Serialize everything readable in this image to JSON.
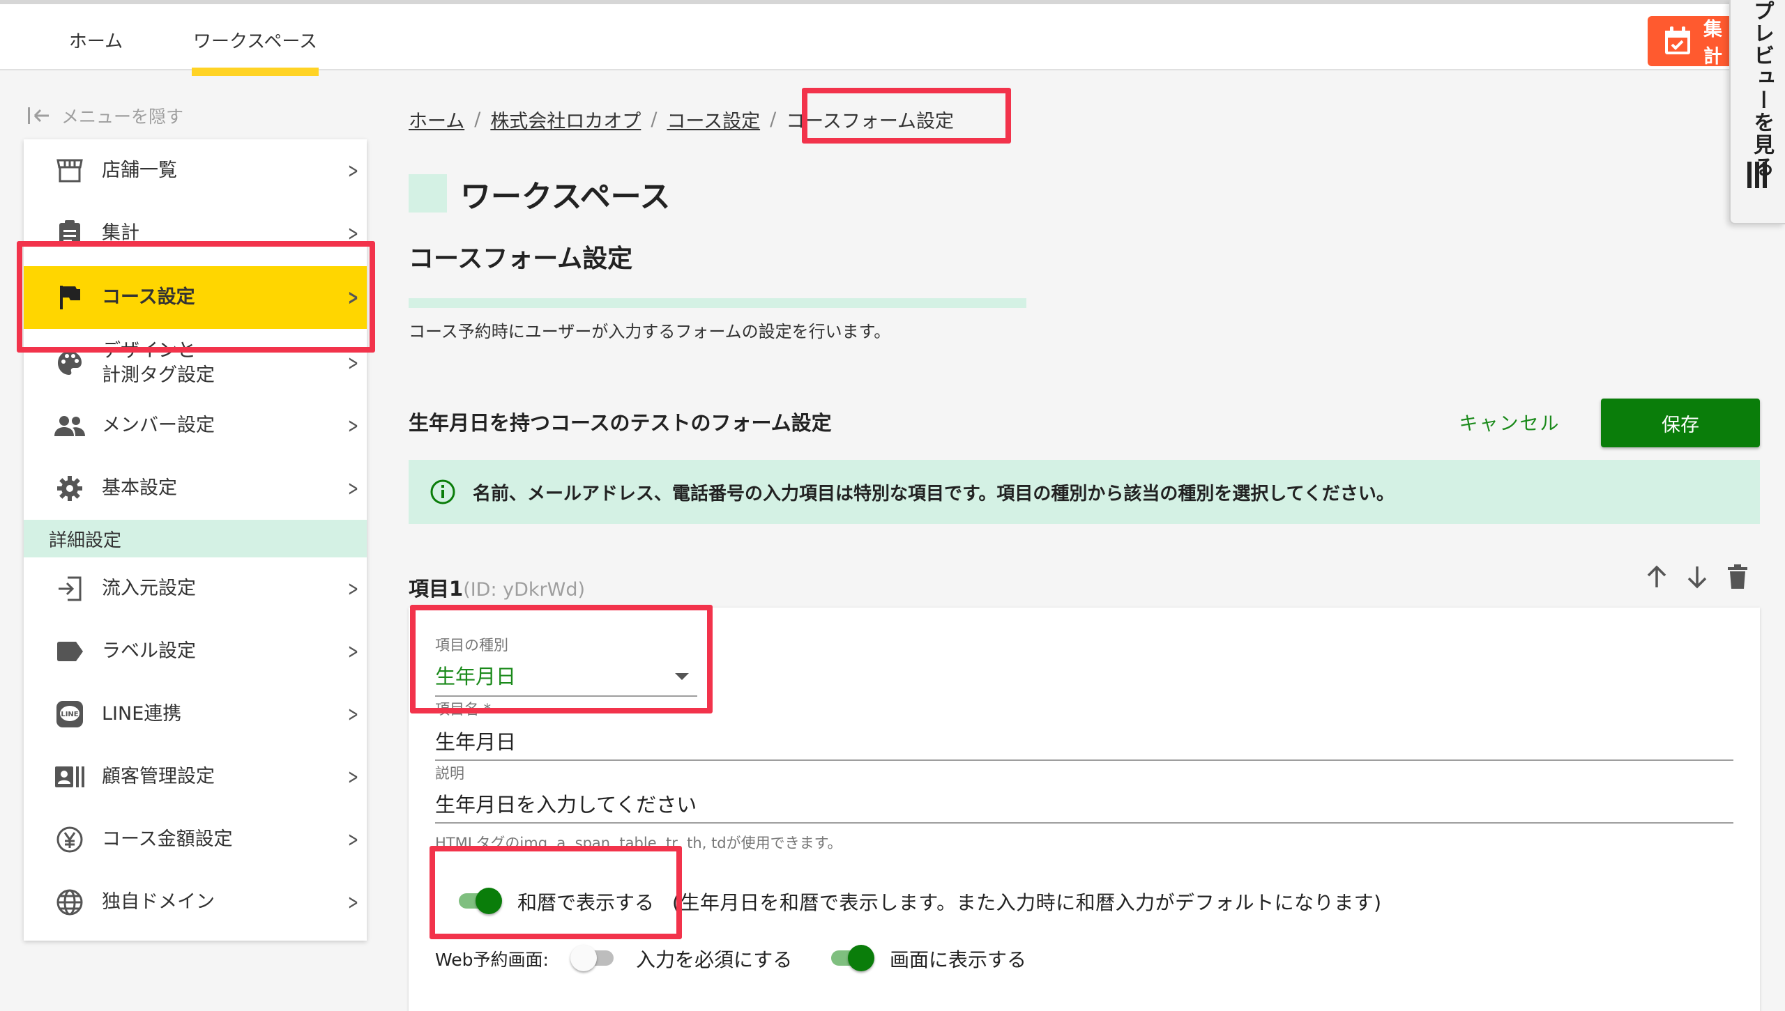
{
  "topnav": {
    "home": "ホーム",
    "workspace": "ワークスペース",
    "aggregate_button": "集計"
  },
  "preview_tab": {
    "label": "プレビューを見る"
  },
  "sidebar": {
    "hide_menu": "メニューを隠す",
    "items": [
      {
        "label": "店舗一覧",
        "icon": "store-icon"
      },
      {
        "label": "集計",
        "icon": "clipboard-icon"
      },
      {
        "label": "コース設定",
        "icon": "flag-icon",
        "active": true
      },
      {
        "label": "デザインと\n計測タグ設定",
        "icon": "palette-icon"
      },
      {
        "label": "メンバー設定",
        "icon": "people-icon"
      },
      {
        "label": "基本設定",
        "icon": "gear-icon"
      }
    ],
    "section_label": "詳細設定",
    "detail_items": [
      {
        "label": "流入元設定",
        "icon": "login-icon"
      },
      {
        "label": "ラベル設定",
        "icon": "label-icon"
      },
      {
        "label": "LINE連携",
        "icon": "line-icon"
      },
      {
        "label": "顧客管理設定",
        "icon": "contacts-icon"
      },
      {
        "label": "コース金額設定",
        "icon": "yen-icon"
      },
      {
        "label": "独自ドメイン",
        "icon": "globe-icon"
      }
    ]
  },
  "breadcrumb": {
    "home": "ホーム",
    "company": "株式会社ロカオプ",
    "course_settings": "コース設定",
    "current": "コースフォーム設定"
  },
  "header": {
    "workspace_title": "ワークスペース",
    "page_title": "コースフォーム設定",
    "description": "コース予約時にユーザーが入力するフォームの設定を行います。"
  },
  "form": {
    "title": "生年月日を持つコースのテストのフォーム設定",
    "cancel_label": "キャンセル",
    "save_label": "保存",
    "info_message": "名前、メールアドレス、電話番号の入力項目は特別な項目です。項目の種別から該当の種別を選択してください。"
  },
  "item": {
    "title": "項目1",
    "id_text": "(ID: yDkrWd)",
    "type_label": "項目の種別",
    "type_value": "生年月日",
    "name_label": "項目名 *",
    "name_value": "生年月日",
    "desc_label": "説明",
    "desc_value": "生年月日を入力してください",
    "hint": "HTMLタグのimg, a, span, table, tr, th, tdが使用できます。",
    "japanese_era_label": "和暦で表示する",
    "japanese_era_note": "(生年月日を和暦で表示します。また入力時に和暦入力がデフォルトになります)",
    "japanese_era_on": true,
    "web_label": "Web予約画面:",
    "required_label": "入力を必須にする",
    "required_on": false,
    "display_label": "画面に表示する",
    "display_on": true
  },
  "colors": {
    "accent_yellow": "#ffd600",
    "primary_green": "#0a7d0a",
    "mint": "#d4f1e4",
    "aggregate_orange": "#ff5a2f",
    "highlight_red": "#f2334b"
  }
}
